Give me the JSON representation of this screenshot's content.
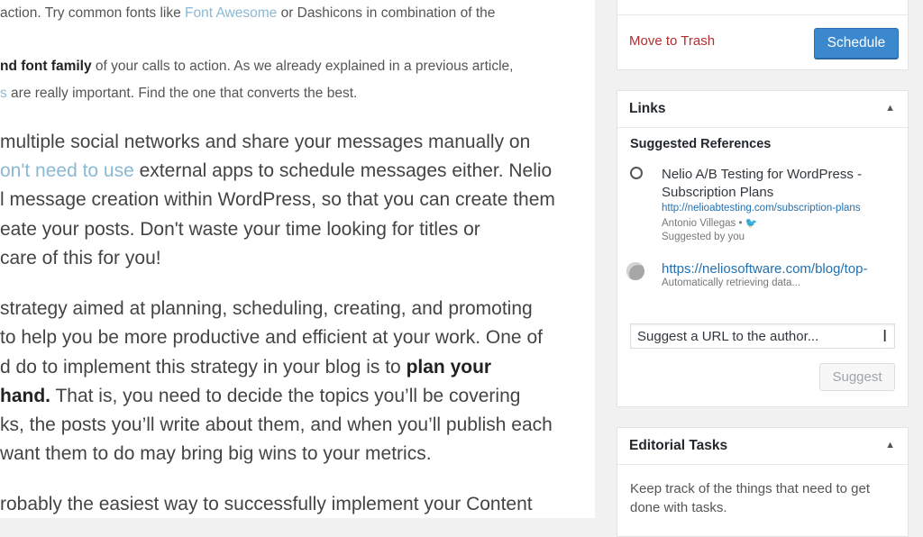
{
  "editor": {
    "line1": {
      "pre": " action. Try common fonts like ",
      "link": "Font Awesome",
      "post": " or Dashicons in combination of the"
    },
    "line2": {
      "bold": "nd font family",
      "post": " of your calls to action. As we already explained in a previous article,"
    },
    "line3": {
      "link": "s",
      "post": " are really important. Find the one that converts the best."
    },
    "para2": {
      "l1": " multiple social networks and share your messages manually on",
      "l2_link": "on't need to use",
      "l2_post": " external apps to schedule messages either. Nelio",
      "l3": "l message creation within WordPress, so that you can create them",
      "l4": "eate your posts. Don't waste your time looking for titles or",
      "l5": " care of this for you!"
    },
    "para3": {
      "l1": "strategy aimed at planning, scheduling, creating, and promoting",
      "l2": "to help you be more productive and efficient at your work. One of",
      "l3_pre": "d do to implement this strategy in your blog is to ",
      "l3_bold": "plan your",
      "l4_bold": "hand.",
      "l4_post": " That is, you need to decide the topics you’ll be covering",
      "l5": "ks, the posts you’ll write about them, and when you’ll publish each",
      "l6": " want them to do may bring big wins to your metrics."
    },
    "para4": {
      "l1": "robably the easiest way to successfully implement your Content"
    }
  },
  "publish": {
    "trash_label": "Move to Trash",
    "schedule_label": "Schedule"
  },
  "links": {
    "title": "Links",
    "toggle": "▲",
    "subtitle": "Suggested References",
    "references": [
      {
        "title": "Nelio A/B Testing for WordPress - Subscription Plans",
        "url": "http://nelioabtesting.com/subscription-plans",
        "author": "Antonio Villegas • ",
        "twitter": "🐦",
        "suggested_by": "Suggested by you"
      },
      {
        "title": "https://neliosoftware.com/blog/top-",
        "status": "Automatically retrieving data..."
      }
    ],
    "input_placeholder": "Suggest a URL to the author...",
    "suggest_label": "Suggest"
  },
  "tasks": {
    "title": "Editorial Tasks",
    "toggle": "▲",
    "description": "Keep track of the things that need to get done with tasks."
  },
  "colors": {
    "accent": "#3c88cf",
    "danger": "#b32d2e",
    "link": "#2271b1"
  }
}
